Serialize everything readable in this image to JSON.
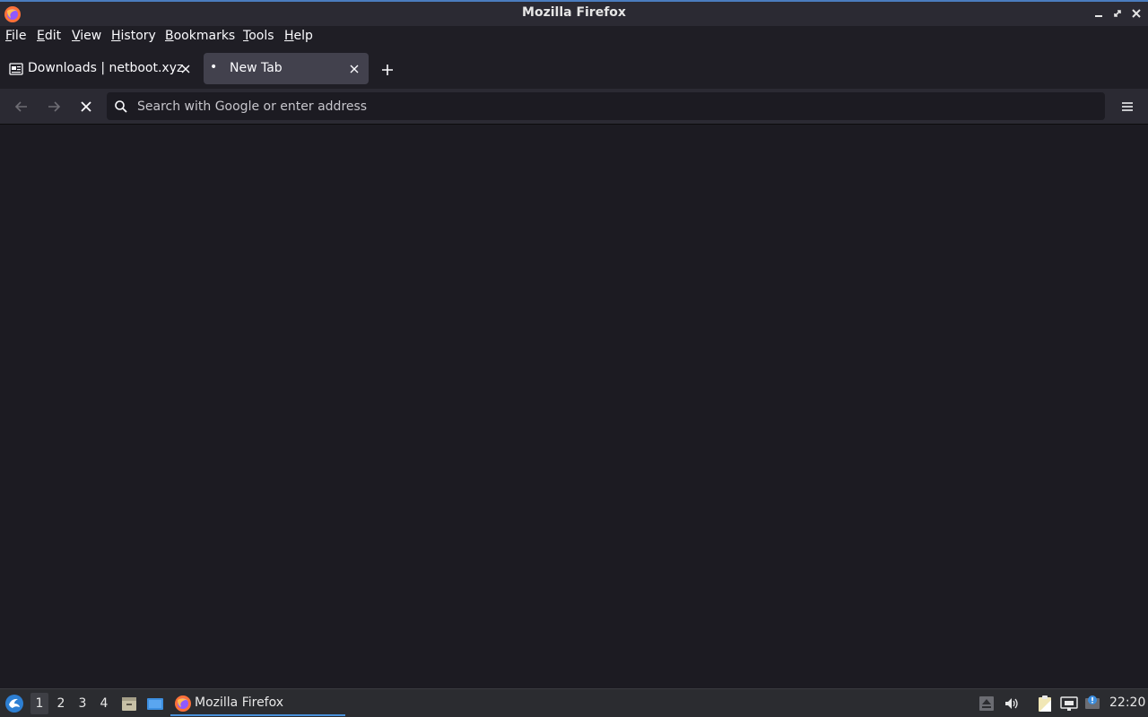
{
  "window": {
    "title": "Mozilla Firefox"
  },
  "menubar": {
    "items": [
      {
        "accel": "F",
        "rest": "ile"
      },
      {
        "accel": "E",
        "rest": "dit"
      },
      {
        "accel": "V",
        "rest": "iew"
      },
      {
        "accel": "H",
        "rest": "istory"
      },
      {
        "accel": "B",
        "rest": "ookmarks"
      },
      {
        "accel": "T",
        "rest": "ools"
      },
      {
        "accel": "H",
        "rest": "elp"
      }
    ]
  },
  "tabs": [
    {
      "label": "Downloads | netboot.xyz",
      "active": false
    },
    {
      "label": "New Tab",
      "active": true,
      "indicator": "•"
    }
  ],
  "urlbar": {
    "placeholder": "Search with Google or enter address",
    "value": ""
  },
  "taskbar": {
    "workspaces": [
      "1",
      "2",
      "3",
      "4"
    ],
    "current_workspace": "1",
    "task_label": "Mozilla Firefox",
    "clock": "22:20"
  },
  "colors": {
    "accent": "#4a90d9",
    "background": "#1c1b22",
    "toolbar": "#2b2a33",
    "active_tab": "#42414d"
  }
}
